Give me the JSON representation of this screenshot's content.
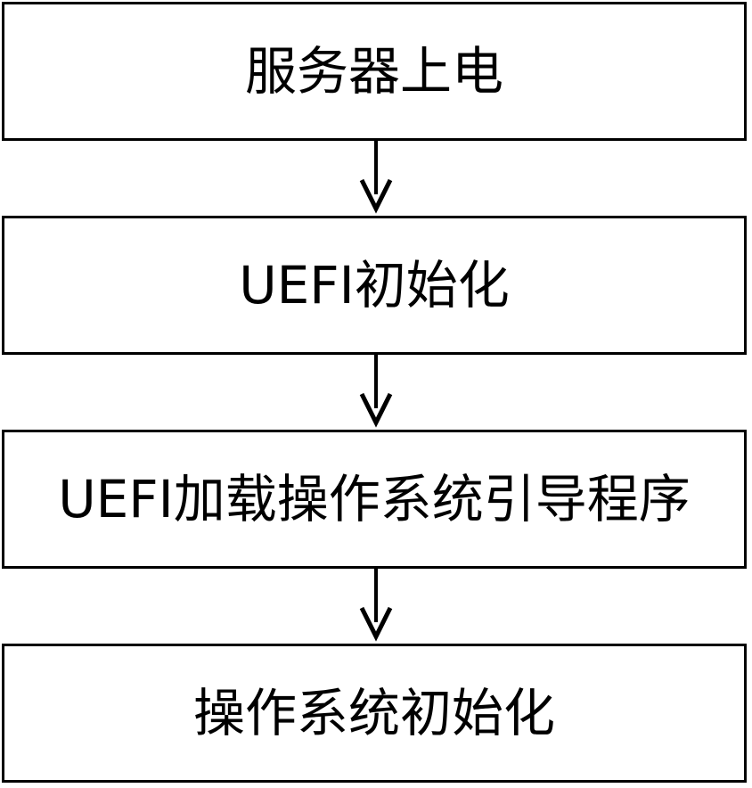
{
  "diagram": {
    "steps": [
      {
        "label": "服务器上电"
      },
      {
        "label": "UEFI初始化"
      },
      {
        "label": "UEFI加载操作系统引导程序"
      },
      {
        "label": "操作系统初始化"
      }
    ],
    "colors": {
      "stroke": "#000000",
      "fill": "#ffffff",
      "text": "#000000"
    }
  }
}
